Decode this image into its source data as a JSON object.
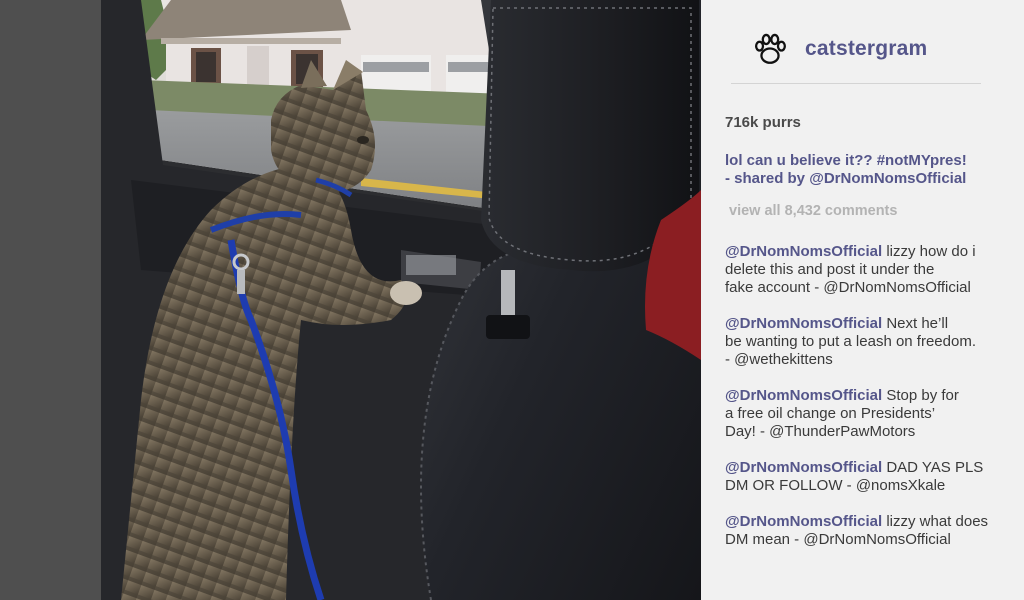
{
  "brand": {
    "name": "catstergram",
    "logo_icon": "paw-print-icon",
    "accent_color": "#55568a"
  },
  "post": {
    "purrs": "716k purrs",
    "caption_lines": [
      "lol can u believe it?? #notMYpres!",
      "- shared by @DrNomNomsOfficial"
    ],
    "view_all_comments": "view all 8,432 comments"
  },
  "comments": [
    {
      "mention": "@DrNomNomsOfficial",
      "first_line": "lizzy how do i",
      "lines": [
        "delete this and post it under the",
        "fake account - @DrNomNomsOfficial"
      ]
    },
    {
      "mention": "@DrNomNomsOfficial",
      "first_line": "Next he’ll",
      "lines": [
        "be wanting to put a leash on freedom.",
        "- @wethekittens"
      ]
    },
    {
      "mention": "@DrNomNomsOfficial",
      "first_line": "Stop by for",
      "lines": [
        "a free oil change on Presidents’",
        "Day! - @ThunderPawMotors"
      ]
    },
    {
      "mention": "@DrNomNomsOfficial",
      "first_line": "DAD YAS PLS",
      "lines": [
        "DM OR FOLLOW - @nomsXkale"
      ]
    },
    {
      "mention": "@DrNomNomsOfficial",
      "first_line": "lizzy what does",
      "lines": [
        "DM mean - @DrNomNomsOfficial"
      ]
    }
  ]
}
